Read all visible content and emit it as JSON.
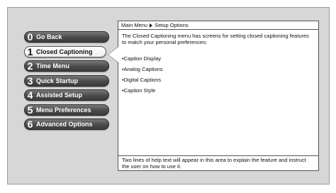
{
  "menu": {
    "items": [
      {
        "num": "0",
        "label": "Go Back"
      },
      {
        "num": "1",
        "label": "Closed Captioning"
      },
      {
        "num": "2",
        "label": "Time Menu"
      },
      {
        "num": "3",
        "label": "Quick Startup"
      },
      {
        "num": "4",
        "label": "Assisted Setup"
      },
      {
        "num": "5",
        "label": "Menu Preferences"
      },
      {
        "num": "6",
        "label": "Advanced Options"
      }
    ],
    "selected_index": 1
  },
  "panel": {
    "breadcrumb": {
      "parent": "Main Menu",
      "current": "Setup Options"
    },
    "description": "The Closed Captioning menu has screens for setting closed captioning features to match your personal preferences:",
    "options": [
      "•Caption Display",
      "•Analog Captions",
      "•Digital Captions",
      "•Caption Style"
    ],
    "help_text": "Two lines of help text will appear in this area to explain the feature and instruct the user on how to use it."
  }
}
